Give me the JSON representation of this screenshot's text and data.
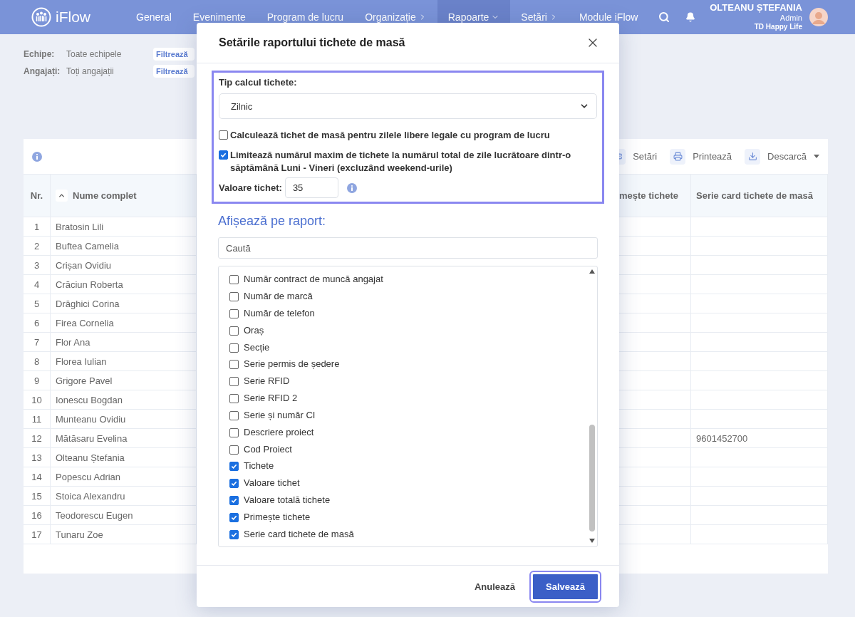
{
  "nav": {
    "brand": "iFlow",
    "items": [
      {
        "label": "General",
        "selected": false
      },
      {
        "label": "Evenimente",
        "selected": false
      },
      {
        "label": "Program de lucru",
        "selected": false
      },
      {
        "label": "Organizație",
        "selected": false,
        "expanded": false
      },
      {
        "label": "Rapoarte",
        "selected": true,
        "expanded": true
      },
      {
        "label": "Setări",
        "selected": false,
        "expanded": false
      },
      {
        "label": "Module iFlow",
        "selected": false
      }
    ],
    "user": {
      "name": "OLTEANU ȘTEFANIA",
      "role": "Admin",
      "company": "TD Happy Life"
    }
  },
  "filters": [
    {
      "label": "Echipe:",
      "value": "Toate echipele",
      "button": "Filtrează"
    },
    {
      "label": "Angajați:",
      "value": "Toți angajații",
      "button": "Filtrează"
    }
  ],
  "toolbar": [
    {
      "label": "Setări",
      "kind": "gear"
    },
    {
      "label": "Printează",
      "kind": "printer"
    },
    {
      "label": "Descarcă",
      "kind": "download",
      "dropdown": true
    }
  ],
  "table": {
    "columns": [
      {
        "label": "Nr."
      },
      {
        "label": "Nume complet",
        "sort_ascending": true
      },
      {
        "label": "mește tichete"
      },
      {
        "label": "Serie card tichete de masă"
      }
    ],
    "rows": [
      {
        "nr": "1",
        "name": "Bratosin Lili"
      },
      {
        "nr": "2",
        "name": "Buftea Camelia"
      },
      {
        "nr": "3",
        "name": "Crișan Ovidiu"
      },
      {
        "nr": "4",
        "name": "Crăciun Roberta"
      },
      {
        "nr": "5",
        "name": "Drăghici Corina"
      },
      {
        "nr": "6",
        "name": "Firea Cornelia"
      },
      {
        "nr": "7",
        "name": "Flor Ana"
      },
      {
        "nr": "8",
        "name": "Florea Iulian"
      },
      {
        "nr": "9",
        "name": "Grigore Pavel"
      },
      {
        "nr": "10",
        "name": "Ionescu Bogdan"
      },
      {
        "nr": "11",
        "name": "Munteanu Ovidiu"
      },
      {
        "nr": "12",
        "name": "Mătăsaru Evelina",
        "card": "9601452700"
      },
      {
        "nr": "13",
        "name": "Olteanu Ștefania"
      },
      {
        "nr": "14",
        "name": "Popescu Adrian"
      },
      {
        "nr": "15",
        "name": "Stoica Alexandru"
      },
      {
        "nr": "16",
        "name": "Teodorescu Eugen"
      },
      {
        "nr": "17",
        "name": "Tunaru Zoe"
      }
    ]
  },
  "modal": {
    "title": "Setările raportului tichete de masă",
    "calc_type": {
      "label": "Tip calcul tichete:",
      "value": "Zilnic"
    },
    "options": [
      {
        "label": "Calculează tichet de masă pentru zilele libere legale cu program de lucru",
        "checked": false
      },
      {
        "label": "Limitează numărul maxim de tichete la numărul total de zile lucrătoare dintr-o săptămână Luni - Vineri (excluzând weekend-urile)",
        "checked": true
      }
    ],
    "ticket_value": {
      "label": "Valoare tichet:",
      "value": "35"
    },
    "display_heading": "Afișează pe raport:",
    "search": {
      "placeholder": "Caută"
    },
    "fields": [
      {
        "label": "Număr contract de muncă angajat",
        "checked": false
      },
      {
        "label": "Număr de marcă",
        "checked": false
      },
      {
        "label": "Număr de telefon",
        "checked": false
      },
      {
        "label": "Oraș",
        "checked": false
      },
      {
        "label": "Secție",
        "checked": false
      },
      {
        "label": "Serie permis de ședere",
        "checked": false
      },
      {
        "label": "Serie RFID",
        "checked": false
      },
      {
        "label": "Serie RFID 2",
        "checked": false
      },
      {
        "label": "Serie și număr CI",
        "checked": false
      },
      {
        "label": "Descriere proiect",
        "checked": false
      },
      {
        "label": "Cod Proiect",
        "checked": false
      },
      {
        "label": "Tichete",
        "checked": true
      },
      {
        "label": "Valoare tichet",
        "checked": true
      },
      {
        "label": "Valoare totală tichete",
        "checked": true
      },
      {
        "label": "Primește tichete",
        "checked": true
      },
      {
        "label": "Serie card tichete de masă",
        "checked": true
      }
    ],
    "buttons": [
      {
        "label": "Anulează",
        "kind": "secondary"
      },
      {
        "label": "Salvează",
        "kind": "primary"
      }
    ]
  }
}
